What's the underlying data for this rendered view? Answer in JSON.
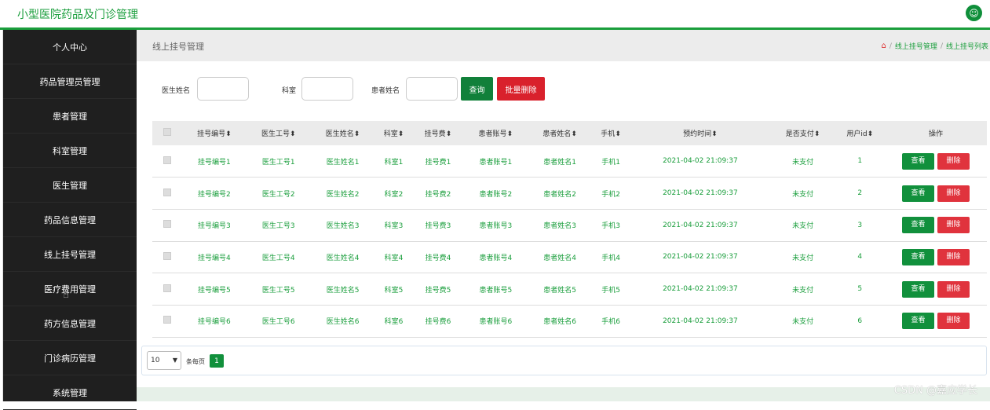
{
  "app": {
    "title": "小型医院药品及门诊管理"
  },
  "sidebar": {
    "items": [
      {
        "label": "个人中心"
      },
      {
        "label": "药品管理员管理"
      },
      {
        "label": "患者管理"
      },
      {
        "label": "科室管理"
      },
      {
        "label": "医生管理"
      },
      {
        "label": "药品信息管理"
      },
      {
        "label": "线上挂号管理"
      },
      {
        "label": "医疗费用管理"
      },
      {
        "label": "药方信息管理"
      },
      {
        "label": "门诊病历管理"
      },
      {
        "label": "系统管理"
      }
    ]
  },
  "breadcrumb": {
    "title": "线上挂号管理",
    "path1": "线上挂号管理",
    "path2": "线上挂号列表",
    "sep": "/"
  },
  "search": {
    "doctor_name_label": "医生姓名",
    "department_label": "科室",
    "patient_name_label": "患者姓名",
    "query_label": "查询",
    "batch_delete_label": "批量删除"
  },
  "table": {
    "headers": [
      "挂号编号",
      "医生工号",
      "医生姓名",
      "科室",
      "挂号费",
      "患者账号",
      "患者姓名",
      "手机",
      "预约时间",
      "是否支付",
      "用户id",
      "操作"
    ],
    "sort_glyph": "⬍",
    "view_label": "查看",
    "delete_label": "删除",
    "rows": [
      {
        "c": [
          "挂号编号1",
          "医生工号1",
          "医生姓名1",
          "科室1",
          "挂号费1",
          "患者账号1",
          "患者姓名1",
          "手机1",
          "2021-04-02 21:09:37",
          "未支付",
          "1"
        ]
      },
      {
        "c": [
          "挂号编号2",
          "医生工号2",
          "医生姓名2",
          "科室2",
          "挂号费2",
          "患者账号2",
          "患者姓名2",
          "手机2",
          "2021-04-02 21:09:37",
          "未支付",
          "2"
        ]
      },
      {
        "c": [
          "挂号编号3",
          "医生工号3",
          "医生姓名3",
          "科室3",
          "挂号费3",
          "患者账号3",
          "患者姓名3",
          "手机3",
          "2021-04-02 21:09:37",
          "未支付",
          "3"
        ]
      },
      {
        "c": [
          "挂号编号4",
          "医生工号4",
          "医生姓名4",
          "科室4",
          "挂号费4",
          "患者账号4",
          "患者姓名4",
          "手机4",
          "2021-04-02 21:09:37",
          "未支付",
          "4"
        ]
      },
      {
        "c": [
          "挂号编号5",
          "医生工号5",
          "医生姓名5",
          "科室5",
          "挂号费5",
          "患者账号5",
          "患者姓名5",
          "手机5",
          "2021-04-02 21:09:37",
          "未支付",
          "5"
        ]
      },
      {
        "c": [
          "挂号编号6",
          "医生工号6",
          "医生姓名6",
          "科室6",
          "挂号费6",
          "患者账号6",
          "患者姓名6",
          "手机6",
          "2021-04-02 21:09:37",
          "未支付",
          "6"
        ]
      }
    ]
  },
  "pager": {
    "page_size": "10",
    "per_page_label": "条每页",
    "current_page": "1"
  },
  "watermark": "CSDN @嘉应学长",
  "colors": {
    "accent": "#1a9e3c",
    "danger": "#d9212c",
    "sidebar": "#1f1f1f"
  }
}
